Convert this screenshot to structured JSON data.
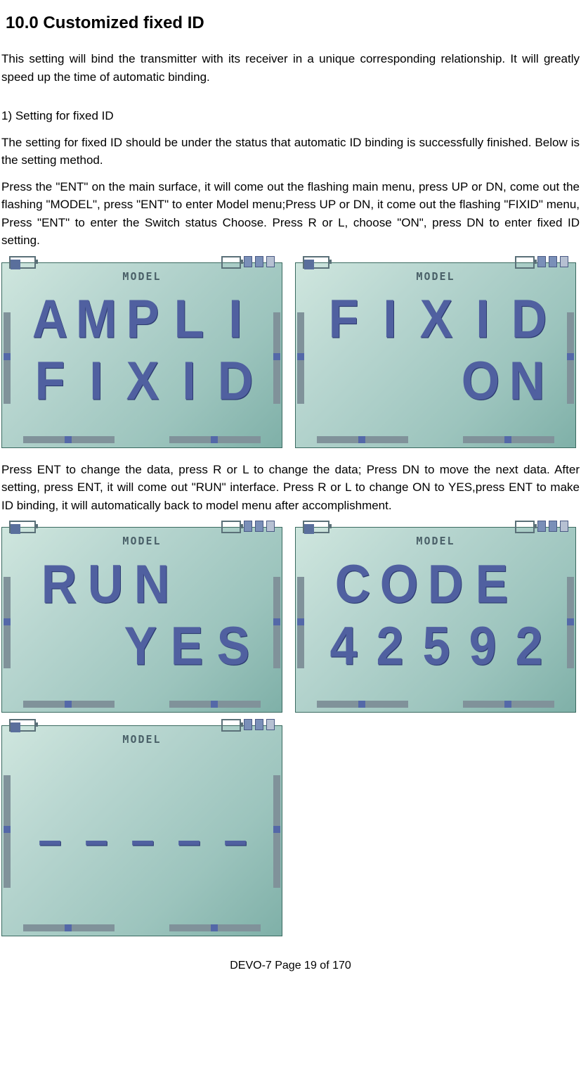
{
  "heading": "10.0 Customized fixed ID",
  "intro": "This setting will bind the transmitter with its receiver in a unique corresponding relationship. It will greatly speed up the time of automatic binding.",
  "step1_label": "1)  Setting for fixed ID",
  "step1_p1": "The setting for fixed ID should be under the status that automatic ID binding is successfully finished. Below is the setting method.",
  "step1_p2": "Press the \"ENT\" on the main surface, it will come out the flashing main menu, press UP or DN, come out the flashing \"MODEL\", press \"ENT\" to enter Model menu;Press UP or DN, it come out the flashing \"FIXID\" menu, Press \"ENT\" to enter the Switch status Choose. Press R or L, choose \"ON\", press DN to enter fixed ID setting.",
  "para2": "Press ENT to change the data, press R or L to change the data; Press DN to move the next data. After setting, press ENT, it will come out \"RUN\" interface. Press R or L to change ON to YES,press ENT to make ID binding, it will automatically back to model menu after accomplishment.",
  "lcd_title": "MODEL",
  "screens": {
    "s1": {
      "line1": "AMPLI",
      "line2": "FIXID"
    },
    "s2": {
      "line1": "FIXID",
      "line2": "ON",
      "line2_align": "right"
    },
    "s3": {
      "line1": "RUN",
      "line2": "YES",
      "line2_align": "right",
      "line1_align": "left-gap"
    },
    "s4": {
      "line1": "CODE",
      "line2": "42592",
      "line1_align": "left-gap"
    },
    "s5": {
      "line1": "",
      "line2": "-----",
      "dashes": true
    }
  },
  "footer": "DEVO-7   Page 19 of 170"
}
